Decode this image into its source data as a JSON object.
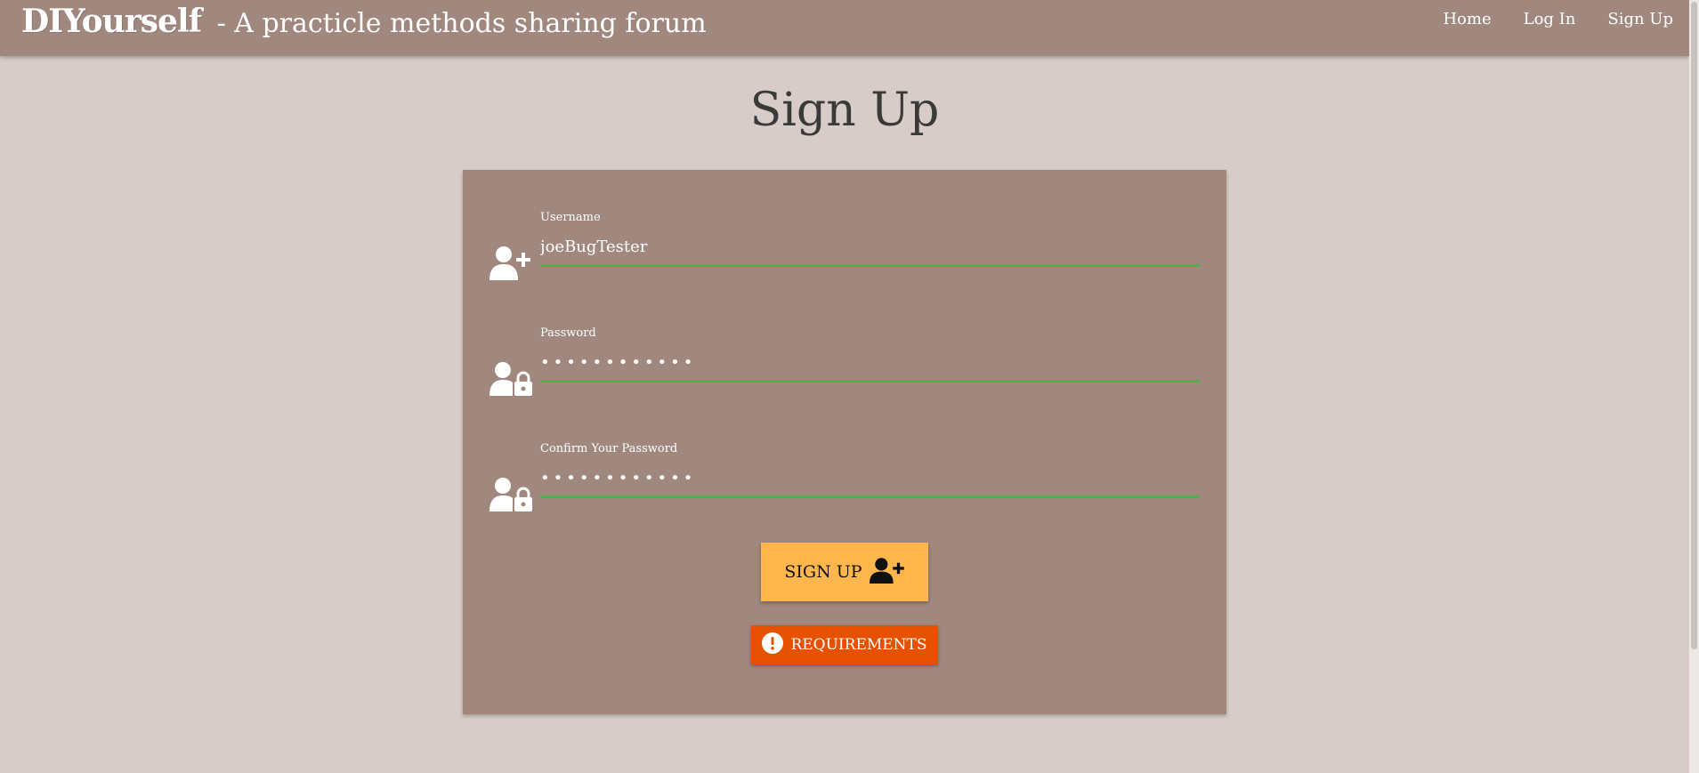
{
  "header": {
    "brand_logo": "DIYourself",
    "brand_tagline": "- A practicle methods sharing forum",
    "nav": [
      {
        "label": "Home"
      },
      {
        "label": "Log In"
      },
      {
        "label": "Sign Up"
      }
    ]
  },
  "page": {
    "title": "Sign Up"
  },
  "form": {
    "username": {
      "label": "Username",
      "value": "joeBugTester",
      "icon": "user-plus-icon"
    },
    "password": {
      "label": "Password",
      "value": "••••••••••••",
      "icon": "user-lock-icon"
    },
    "confirm_password": {
      "label": "Confirm Your Password",
      "value": "••••••••••••",
      "icon": "user-lock-icon"
    },
    "signup_button": {
      "label": "Sign Up",
      "icon": "user-plus-icon"
    },
    "requirements_button": {
      "label": "Requirements",
      "icon": "exclamation-circle-icon"
    }
  },
  "colors": {
    "background": "#d7ccc8",
    "navbar": "#a1887f",
    "card": "#a1887f",
    "input_underline_valid": "#4caf50",
    "signup_button": "#ffb74d",
    "requirements_button": "#e65100"
  }
}
